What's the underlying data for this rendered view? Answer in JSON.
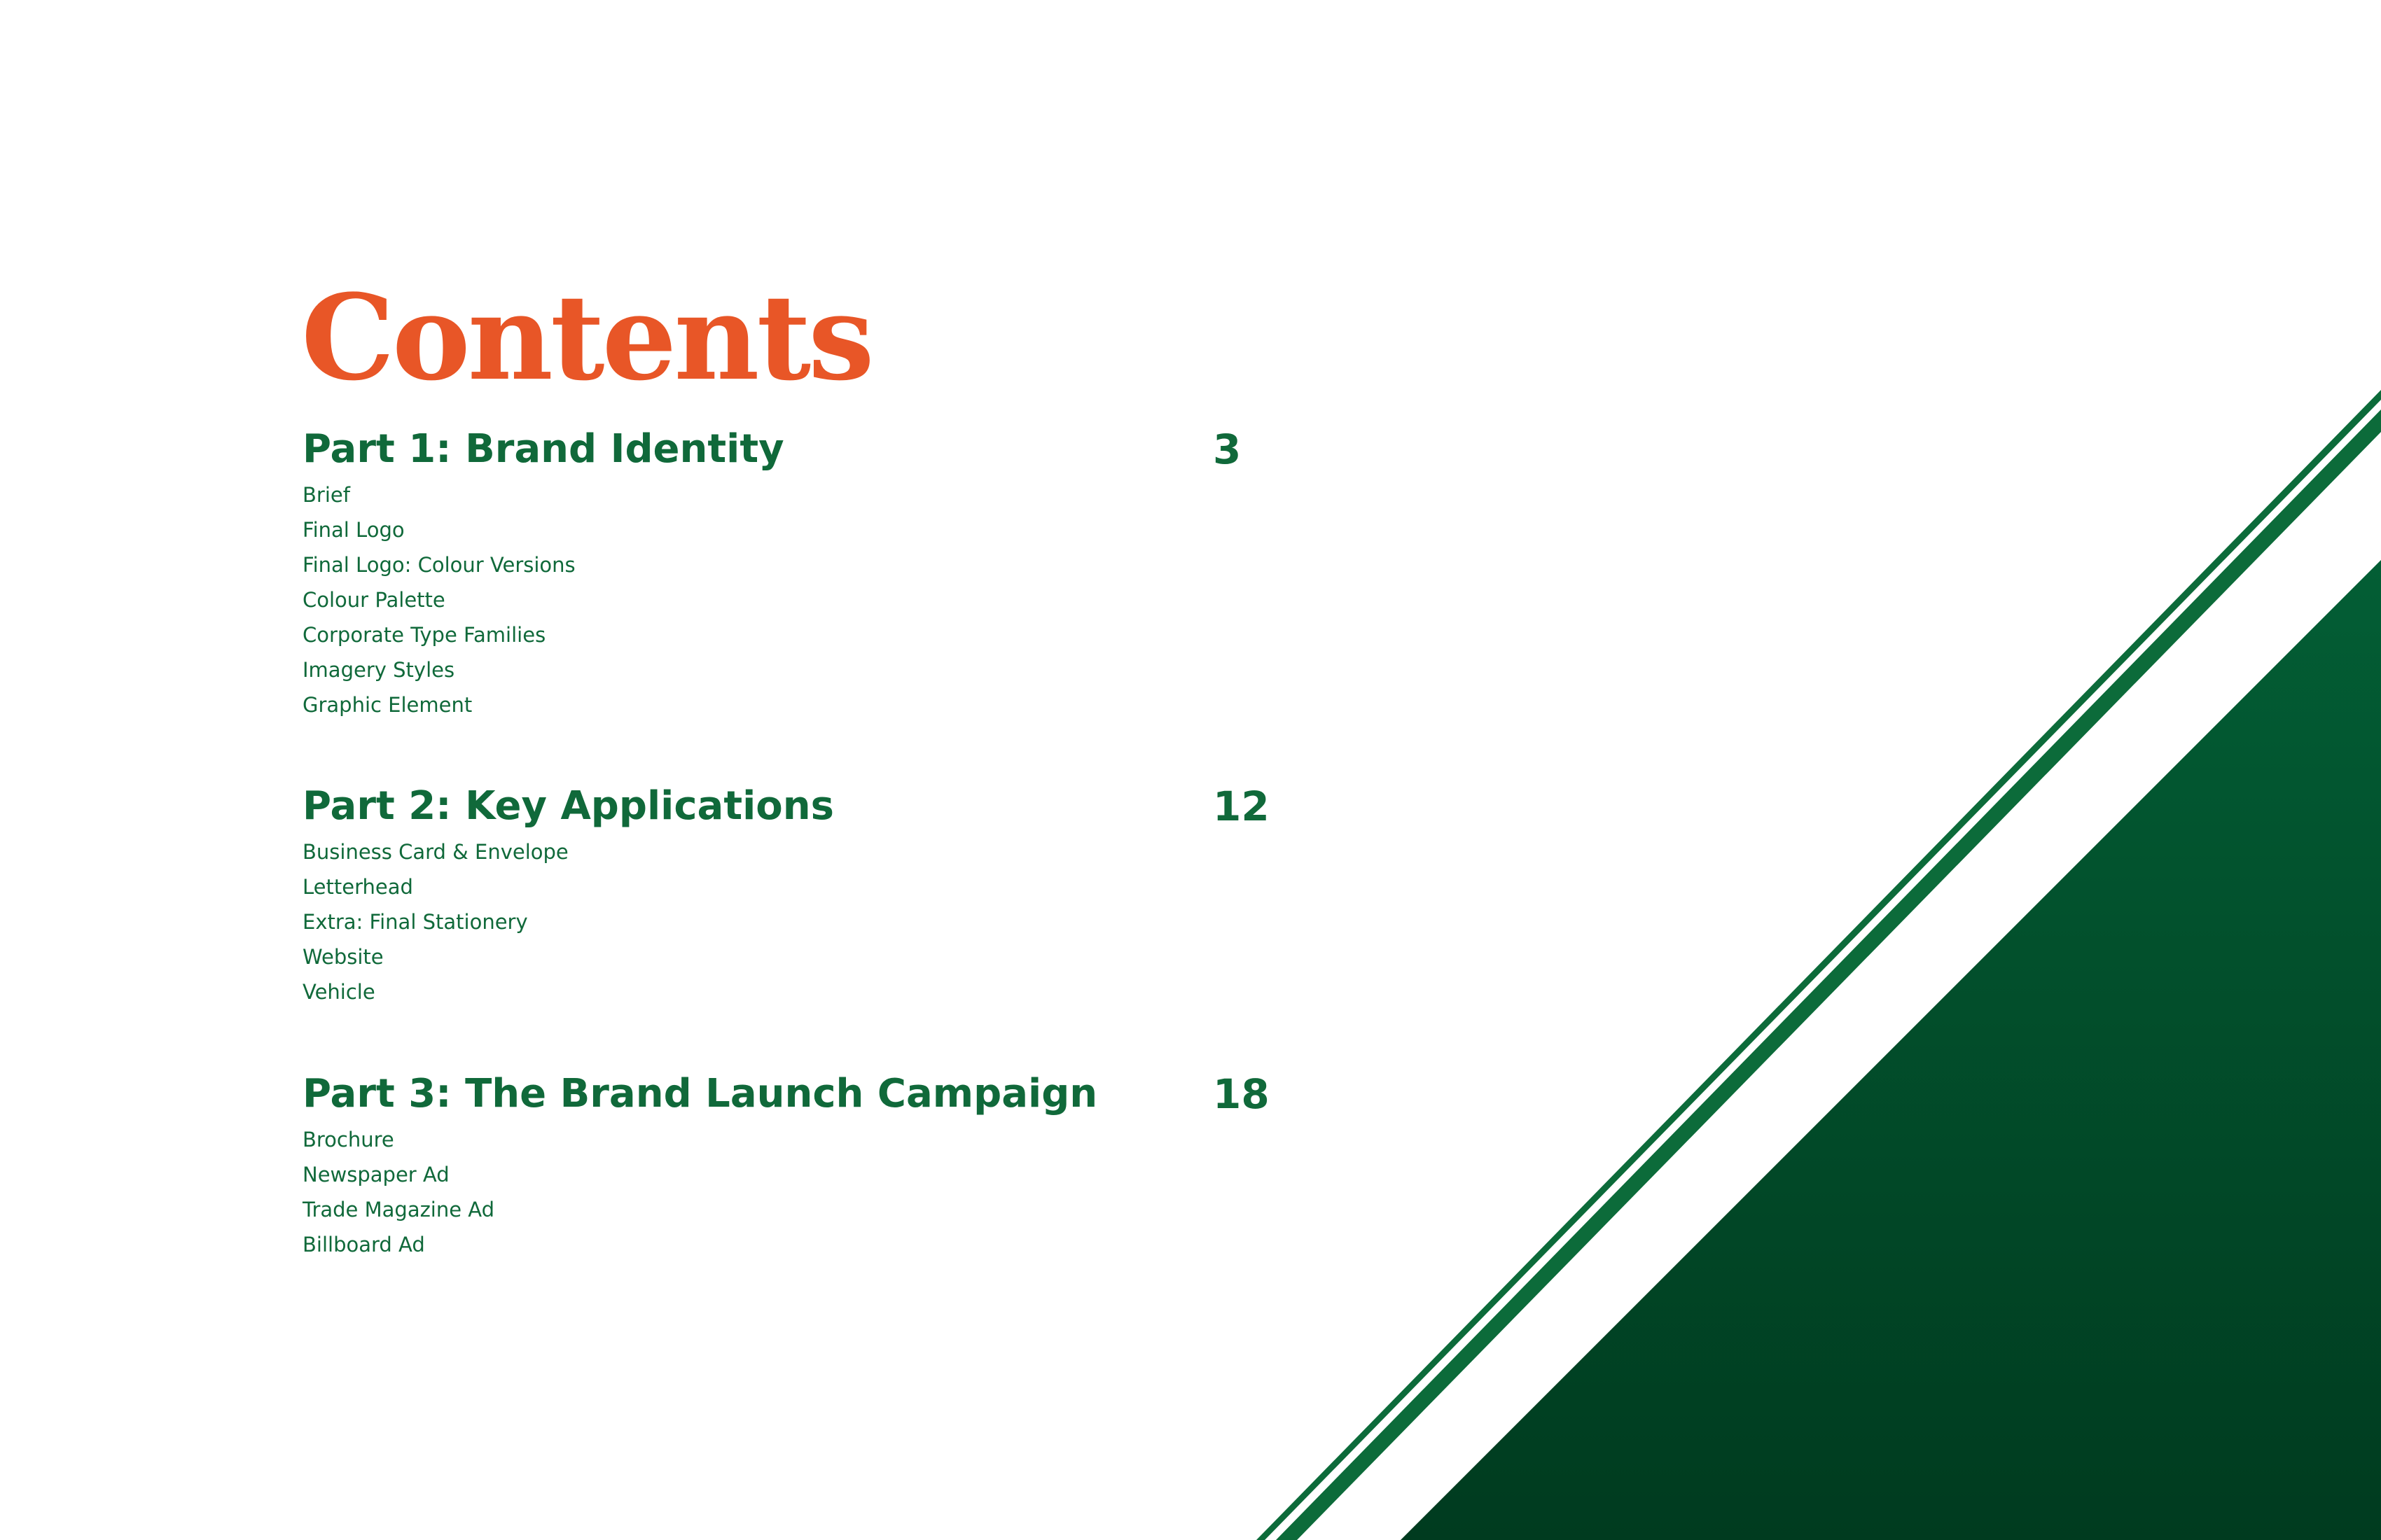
{
  "title": "Contents",
  "sections": [
    {
      "title": "Part 1: Brand Identity",
      "page": "3",
      "items": [
        "Brief",
        "Final Logo",
        "Final Logo: Colour Versions",
        "Colour Palette",
        "Corporate Type Families",
        "Imagery Styles",
        "Graphic Element"
      ]
    },
    {
      "title": "Part 2: Key Applications",
      "page": "12",
      "items": [
        "Business Card & Envelope",
        "Letterhead",
        "Extra: Final Stationery",
        "Website",
        "Vehicle"
      ]
    },
    {
      "title": "Part 3: The Brand Launch Campaign",
      "page": "18",
      "items": [
        "Brochure",
        "Newspaper Ad",
        "Trade Magazine Ad",
        "Billboard Ad"
      ]
    }
  ],
  "colors": {
    "title": "#e85627",
    "text": "#10693a",
    "decor_light": "#035e35",
    "decor_dark": "#003b1f",
    "background": "#ffffff"
  }
}
